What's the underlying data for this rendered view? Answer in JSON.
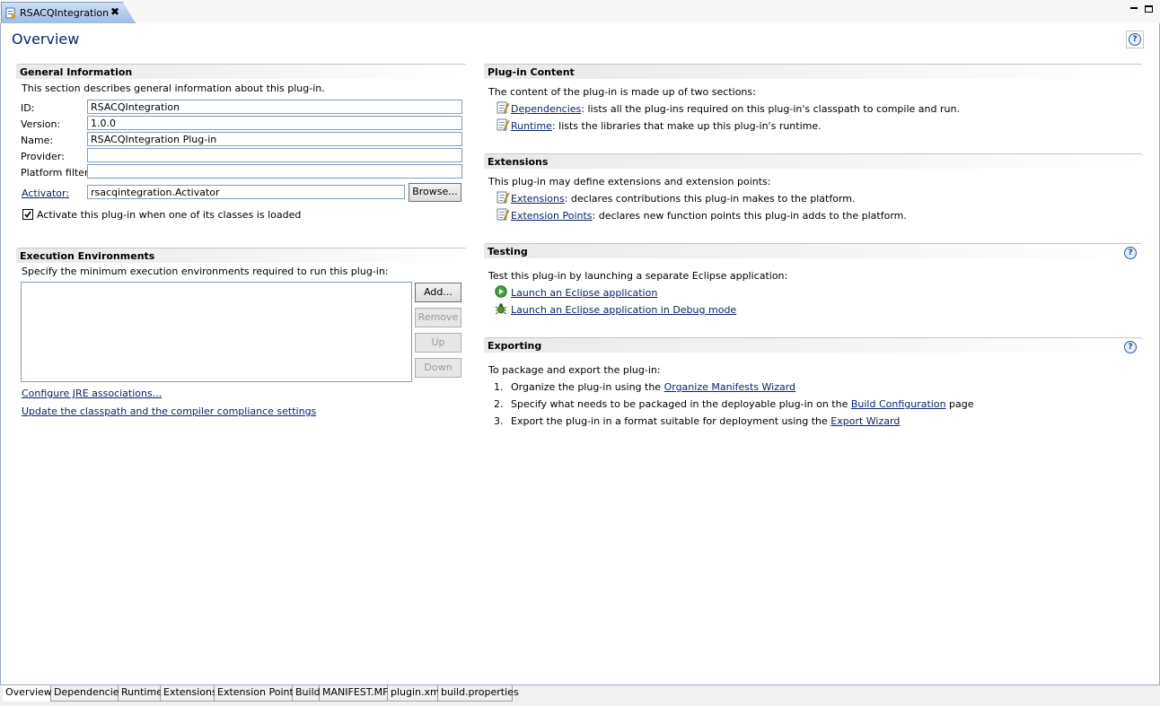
{
  "editor": {
    "tab_title": "RSACQIntegration",
    "page_title": "Overview"
  },
  "general": {
    "header": "General Information",
    "description": "This section describes general information about this plug-in.",
    "id_label": "ID:",
    "id_value": "RSACQIntegration",
    "version_label": "Version:",
    "version_value": "1.0.0",
    "name_label": "Name:",
    "name_value": "RSACQIntegration Plug-in",
    "provider_label": "Provider:",
    "provider_value": "",
    "platform_label": "Platform filter:",
    "platform_value": "",
    "activator_label": "Activator:",
    "activator_value": "rsacqintegration.Activator",
    "browse_label": "Browse...",
    "activate_checkbox_label": "Activate this plug-in when one of its classes is loaded",
    "activate_checked": true
  },
  "exec_env": {
    "header": "Execution Environments",
    "description": "Specify the minimum execution environments required to run this plug-in:",
    "add_label": "Add...",
    "remove_label": "Remove",
    "up_label": "Up",
    "down_label": "Down",
    "configure_link": "Configure JRE associations...",
    "update_link": "Update the classpath and the compiler compliance settings"
  },
  "plugin_content": {
    "header": "Plug-in Content",
    "description": "The content of the plug-in is made up of two sections:",
    "items": [
      {
        "link": "Dependencies",
        "text": ": lists all the plug-ins required on this plug-in's classpath to compile and run."
      },
      {
        "link": "Runtime",
        "text": ": lists the libraries that make up this plug-in's runtime."
      }
    ]
  },
  "extensions": {
    "header": "Extensions",
    "description": "This plug-in may define extensions and extension points:",
    "items": [
      {
        "link": "Extensions",
        "text": ": declares contributions this plug-in makes to the platform."
      },
      {
        "link": "Extension Points",
        "text": ": declares new function points this plug-in adds to the platform."
      }
    ]
  },
  "testing": {
    "header": "Testing",
    "description": "Test this plug-in by launching a separate Eclipse application:",
    "launch_link": "Launch an Eclipse application",
    "debug_link": "Launch an Eclipse application in Debug mode"
  },
  "exporting": {
    "header": "Exporting",
    "description": "To package and export the plug-in:",
    "steps": [
      {
        "num": "1.",
        "text": "Organize the plug-in using the ",
        "link": "Organize Manifests Wizard",
        "after": ""
      },
      {
        "num": "2.",
        "text": "Specify what needs to be packaged in the deployable plug-in on the ",
        "link": "Build Configuration",
        "after": " page"
      },
      {
        "num": "3.",
        "text": "Export the plug-in in a format suitable for deployment using the ",
        "link": "Export Wizard",
        "after": ""
      }
    ]
  },
  "bottom_tabs": [
    "Overview",
    "Dependencies",
    "Runtime",
    "Extensions",
    "Extension Points",
    "Build",
    "MANIFEST.MF",
    "plugin.xml",
    "build.properties"
  ],
  "help_glyph": "?",
  "close_glyph": "✖",
  "colors": {
    "link": "#0a246a",
    "title": "#0a246a",
    "accent": "#7f9db9"
  }
}
